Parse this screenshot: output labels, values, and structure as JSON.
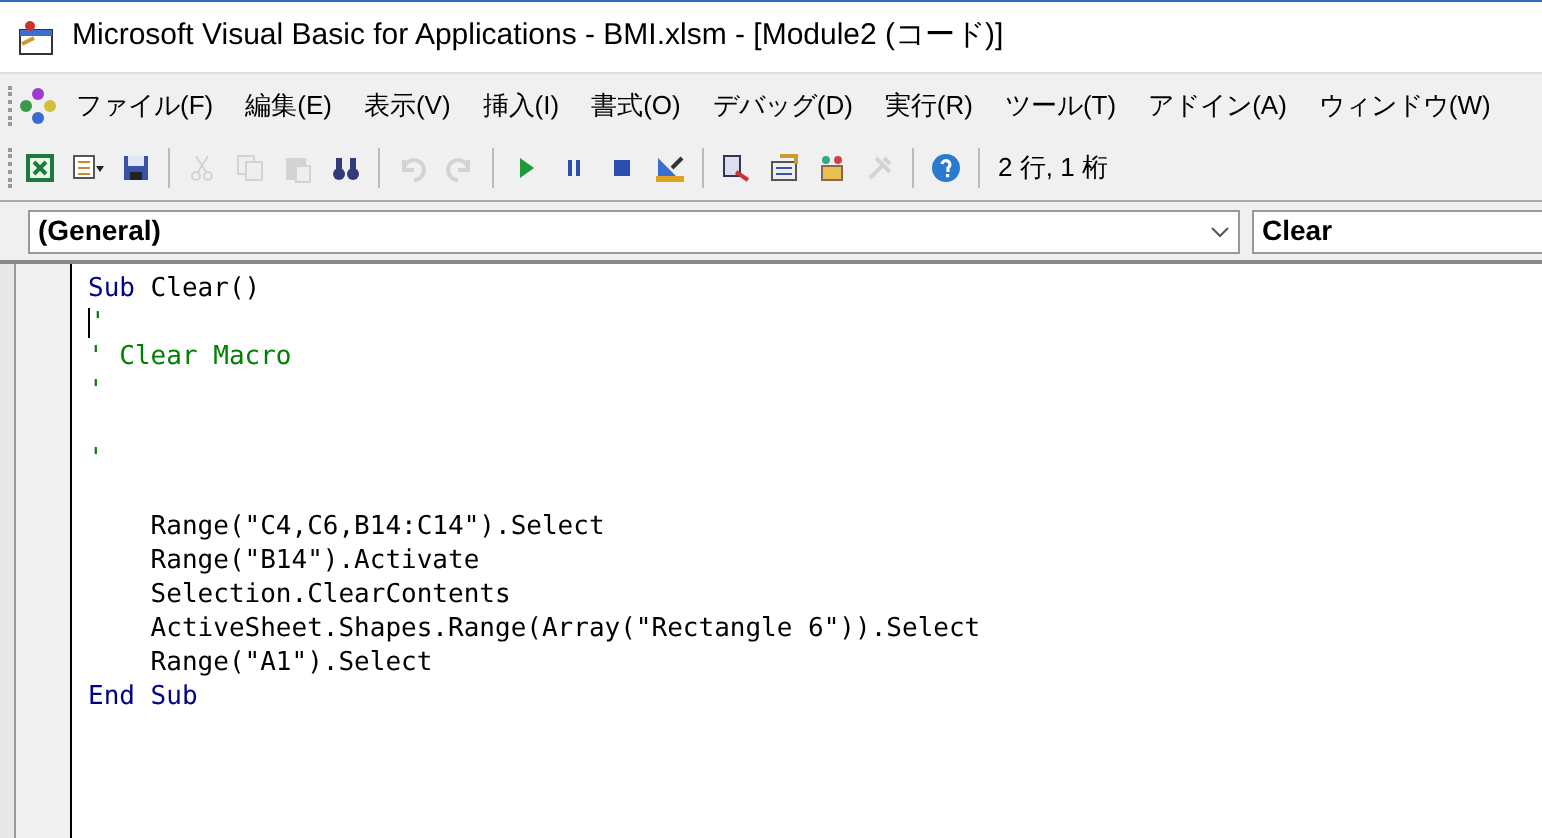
{
  "window": {
    "title": "Microsoft Visual Basic for Applications - BMI.xlsm - [Module2 (コード)]"
  },
  "menu": [
    {
      "label": "ファイル(F)"
    },
    {
      "label": "編集(E)"
    },
    {
      "label": "表示(V)"
    },
    {
      "label": "挿入(I)"
    },
    {
      "label": "書式(O)"
    },
    {
      "label": "デバッグ(D)"
    },
    {
      "label": "実行(R)"
    },
    {
      "label": "ツール(T)"
    },
    {
      "label": "アドイン(A)"
    },
    {
      "label": "ウィンドウ(W)"
    }
  ],
  "toolbar": [
    {
      "kind": "excel",
      "disabled": false
    },
    {
      "kind": "insert-menu",
      "disabled": false
    },
    {
      "kind": "save",
      "disabled": false
    },
    {
      "kind": "separator"
    },
    {
      "kind": "cut",
      "disabled": true
    },
    {
      "kind": "copy",
      "disabled": true
    },
    {
      "kind": "paste",
      "disabled": true
    },
    {
      "kind": "find",
      "disabled": false
    },
    {
      "kind": "separator"
    },
    {
      "kind": "undo",
      "disabled": true
    },
    {
      "kind": "redo",
      "disabled": true
    },
    {
      "kind": "separator"
    },
    {
      "kind": "run",
      "disabled": false
    },
    {
      "kind": "pause",
      "disabled": false
    },
    {
      "kind": "stop",
      "disabled": false
    },
    {
      "kind": "design",
      "disabled": false
    },
    {
      "kind": "separator"
    },
    {
      "kind": "project",
      "disabled": false
    },
    {
      "kind": "properties",
      "disabled": false
    },
    {
      "kind": "objects",
      "disabled": false
    },
    {
      "kind": "toolbox",
      "disabled": true
    },
    {
      "kind": "separator"
    },
    {
      "kind": "help",
      "disabled": false
    },
    {
      "kind": "separator"
    }
  ],
  "cursor_position": "2 行, 1 桁",
  "object_combo": {
    "value": "(General)"
  },
  "procedure_combo": {
    "value": "Clear"
  },
  "code": {
    "lines": [
      {
        "kind": "code",
        "segments": [
          {
            "text": "Sub",
            "kind": "keyword"
          },
          {
            "text": " Clear()",
            "kind": "plain"
          }
        ]
      },
      {
        "kind": "code",
        "segments": [
          {
            "kind": "caret"
          },
          {
            "text": "'",
            "kind": "comment"
          }
        ]
      },
      {
        "kind": "code",
        "segments": [
          {
            "text": "' Clear Macro",
            "kind": "comment"
          }
        ]
      },
      {
        "kind": "code",
        "segments": [
          {
            "text": "'",
            "kind": "comment"
          }
        ]
      },
      {
        "kind": "blank"
      },
      {
        "kind": "code",
        "segments": [
          {
            "text": "'",
            "kind": "comment"
          }
        ]
      },
      {
        "kind": "blank"
      },
      {
        "kind": "code",
        "segments": [
          {
            "text": "    Range(\"C4,C6,B14:C14\").Select",
            "kind": "plain"
          }
        ]
      },
      {
        "kind": "code",
        "segments": [
          {
            "text": "    Range(\"B14\").Activate",
            "kind": "plain"
          }
        ]
      },
      {
        "kind": "code",
        "segments": [
          {
            "text": "    Selection.ClearContents",
            "kind": "plain"
          }
        ]
      },
      {
        "kind": "code",
        "segments": [
          {
            "text": "    ActiveSheet.Shapes.Range(Array(\"Rectangle 6\")).Select",
            "kind": "plain"
          }
        ]
      },
      {
        "kind": "code",
        "segments": [
          {
            "text": "    Range(\"A1\").Select",
            "kind": "plain"
          }
        ]
      },
      {
        "kind": "code",
        "segments": [
          {
            "text": "End Sub",
            "kind": "keyword"
          }
        ]
      }
    ]
  }
}
